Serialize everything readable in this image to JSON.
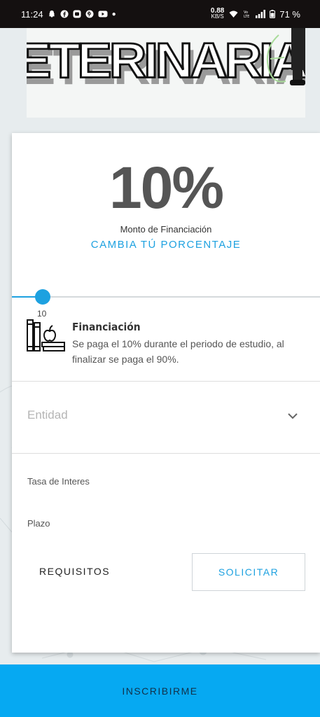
{
  "status_bar": {
    "time": "11:24",
    "net_speed": "0.88",
    "net_unit": "KB/S",
    "battery": "71 %",
    "icons": [
      "snapchat-icon",
      "facebook-icon",
      "messenger-icon",
      "pinterest-icon",
      "youtube-icon",
      "wifi-icon",
      "volte-icon",
      "signal-icon",
      "battery-icon"
    ]
  },
  "banner": {
    "text": "ETERINARIA"
  },
  "financing": {
    "percent": "10%",
    "amount_label": "Monto de Financiación",
    "change_link": "CAMBIA TÚ PORCENTAJE",
    "slider_value": "10",
    "slider_fraction": 0.1,
    "title": "Financiación",
    "description": "Se paga el 10% durante el periodo de estudio, al finalizar se paga el 90%."
  },
  "form": {
    "entity_placeholder": "Entidad",
    "rate_label": "Tasa de Interes",
    "term_label": "Plazo",
    "requirements_button": "REQUISITOS",
    "apply_button": "SOLICITAR"
  },
  "bottom": {
    "enroll_button": "INSCRIBIRME"
  },
  "colors": {
    "accent": "#1da1e0",
    "bottom_bar": "#06a9f2",
    "status_bar": "#141010"
  }
}
